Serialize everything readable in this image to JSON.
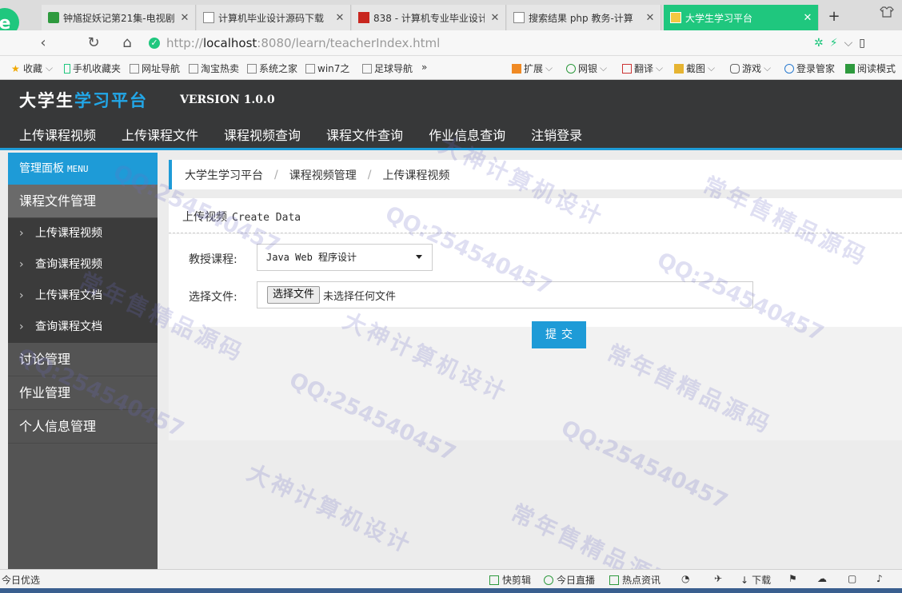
{
  "browser": {
    "tabs": [
      {
        "label": "钟馗捉妖记第21集-电视剧",
        "favicon": "video-icon",
        "active": false
      },
      {
        "label": "计算机毕业设计源码下载",
        "favicon": "page-icon",
        "active": false
      },
      {
        "label": "838 - 计算机专业毕业设计",
        "favicon": "red-page-icon",
        "active": false
      },
      {
        "label": "搜索结果 php 教务-计算",
        "favicon": "page-icon",
        "active": false
      },
      {
        "label": "大学生学习平台",
        "favicon": "app-icon",
        "active": true
      }
    ],
    "close_glyph": "✕",
    "new_tab": "+",
    "url_scheme": "http://",
    "url_host": "localhost",
    "url_rest": ":8080/learn/teacherIndex.html",
    "bookmarks_left": [
      "收藏",
      "手机收藏夹",
      "网址导航",
      "淘宝热卖",
      "系统之家",
      "win7之",
      "足球导航",
      "»"
    ],
    "bookmarks_right": [
      "扩展",
      "网银",
      "翻译",
      "截图",
      "游戏",
      "登录管家",
      "阅读模式"
    ]
  },
  "header": {
    "brand_prefix": "大学生",
    "brand_highlight": "学习平台",
    "version": "VERSION 1.0.0",
    "nav": [
      "上传课程视频",
      "上传课程文件",
      "课程视频查询",
      "课程文件查询",
      "作业信息查询",
      "注销登录"
    ]
  },
  "sidebar": {
    "title": "管理面板",
    "title_en": "MENU",
    "groups": [
      {
        "label": "课程文件管理",
        "open": true,
        "items": [
          "上传课程视频",
          "查询课程视频",
          "上传课程文档",
          "查询课程文档"
        ]
      },
      {
        "label": "讨论管理",
        "open": false,
        "items": []
      },
      {
        "label": "作业管理",
        "open": false,
        "items": []
      },
      {
        "label": "个人信息管理",
        "open": false,
        "items": []
      }
    ]
  },
  "breadcrumb": [
    "大学生学习平台",
    "课程视频管理",
    "上传课程视频"
  ],
  "breadcrumb_sep": "/",
  "form": {
    "title": "上传视频",
    "title_en": "Create Data",
    "course_label": "教授课程:",
    "course_value": "Java Web 程序设计",
    "file_label": "选择文件:",
    "file_button": "选择文件",
    "file_status": "未选择任何文件",
    "submit": "提交"
  },
  "statusbar": {
    "left": "今日优选",
    "items": [
      "快剪辑",
      "今日直播",
      "热点资讯",
      "下载"
    ]
  },
  "watermarks": {
    "qq": "QQ:254540457",
    "design": "大神计算机设计",
    "source": "常年售精品源码"
  }
}
